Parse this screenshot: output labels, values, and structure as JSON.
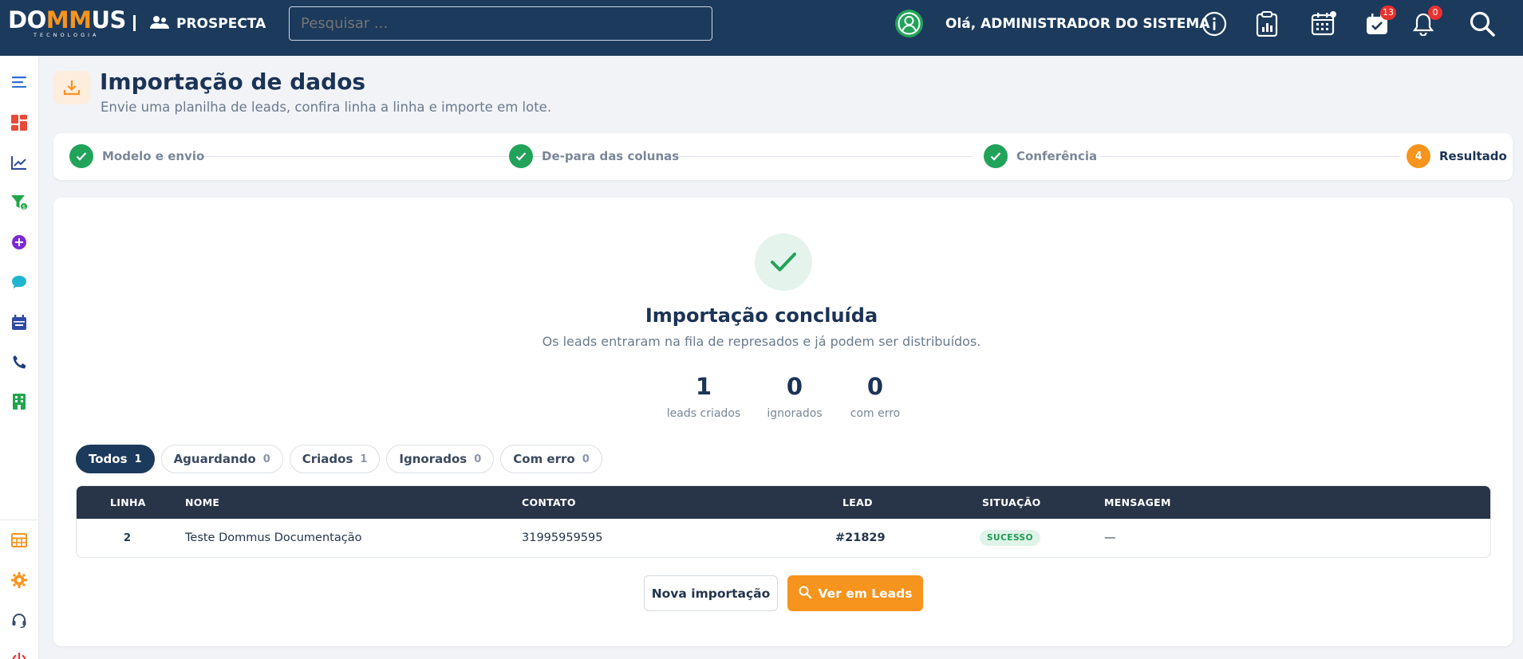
{
  "header": {
    "logo_text_left": "DO",
    "logo_text_mid": "MM",
    "logo_text_right": "US",
    "logo_sub": "TECNOLOGIA",
    "module_name": "PROSPECTA",
    "search_placeholder": "Pesquisar ...",
    "greeting": "Olá, ADMINISTRADOR DO SISTEMA",
    "tasks_badge": "13",
    "notifications_badge": "0"
  },
  "sidebar": {
    "items": [
      "menu-icon",
      "dashboard-icon",
      "chart-icon",
      "funnel-icon",
      "add-icon",
      "chat-icon",
      "calendar-icon",
      "phone-icon",
      "building-icon",
      "table-icon",
      "gear-icon",
      "headset-icon",
      "power-icon"
    ]
  },
  "page": {
    "title": "Importação de dados",
    "subtitle": "Envie uma planilha de leads, confira linha a linha e importe em lote."
  },
  "stepper": {
    "steps": [
      {
        "label": "Modelo e envio",
        "state": "done"
      },
      {
        "label": "De-para das colunas",
        "state": "done"
      },
      {
        "label": "Conferência",
        "state": "done"
      },
      {
        "label": "Resultado",
        "state": "active",
        "number": "4"
      }
    ]
  },
  "result": {
    "title": "Importação concluída",
    "subtitle": "Os leads entraram na fila de represados e já podem ser distribuídos.",
    "stats": [
      {
        "value": "1",
        "label": "leads criados"
      },
      {
        "value": "0",
        "label": "ignorados"
      },
      {
        "value": "0",
        "label": "com erro"
      }
    ]
  },
  "filters": [
    {
      "label": "Todos",
      "count": "1",
      "active": true
    },
    {
      "label": "Aguardando",
      "count": "0",
      "active": false
    },
    {
      "label": "Criados",
      "count": "1",
      "active": false
    },
    {
      "label": "Ignorados",
      "count": "0",
      "active": false
    },
    {
      "label": "Com erro",
      "count": "0",
      "active": false
    }
  ],
  "table": {
    "columns": [
      "LINHA",
      "NOME",
      "CONTATO",
      "LEAD",
      "SITUAÇÃO",
      "MENSAGEM"
    ],
    "rows": [
      {
        "linha": "2",
        "nome": "Teste Dommus Documentação",
        "contato": "31995959595",
        "lead": "#21829",
        "situacao": "SUCESSO",
        "mensagem": "—"
      }
    ]
  },
  "actions": {
    "new_import": "Nova importação",
    "view_leads": "Ver em Leads"
  },
  "colors": {
    "navy": "#1b3a5c",
    "orange": "#f7941d",
    "green": "#21a35a"
  }
}
